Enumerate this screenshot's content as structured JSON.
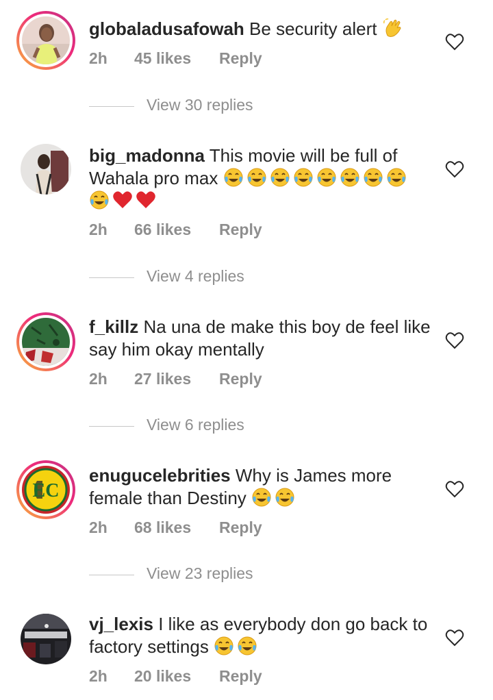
{
  "comments": [
    {
      "username": "globaladusafowah",
      "text": "Be security alert ",
      "emoji_trail": [
        "waving-hand"
      ],
      "time": "2h",
      "likes": "45 likes",
      "reply": "Reply",
      "view_replies": "View 30 replies"
    },
    {
      "username": "big_madonna",
      "text": "This movie will be full of Wahala pro max ",
      "emoji_trail": [
        "tears-of-joy",
        "tears-of-joy",
        "tears-of-joy",
        "tears-of-joy",
        "tears-of-joy",
        "tears-of-joy",
        "tears-of-joy",
        "tears-of-joy",
        "tears-of-joy",
        "red-heart",
        "red-heart"
      ],
      "time": "2h",
      "likes": "66 likes",
      "reply": "Reply",
      "view_replies": "View 4 replies"
    },
    {
      "username": "f_killz",
      "text": "Na una de make this boy de feel like say him okay mentally",
      "emoji_trail": [],
      "time": "2h",
      "likes": "27 likes",
      "reply": "Reply",
      "view_replies": "View 6 replies"
    },
    {
      "username": "enugucelebrities",
      "text": "Why is James more female than Destiny ",
      "emoji_trail": [
        "tears-of-joy",
        "tears-of-joy"
      ],
      "time": "2h",
      "likes": "68 likes",
      "reply": "Reply",
      "view_replies": "View 23 replies"
    },
    {
      "username": "vj_lexis",
      "text": "I like as everybody don go back to factory settings ",
      "emoji_trail": [
        "tears-of-joy",
        "tears-of-joy"
      ],
      "time": "2h",
      "likes": "20 likes",
      "reply": "Reply"
    }
  ],
  "colors": {
    "text": "#262626",
    "muted": "#8e8e8e",
    "story_ring_start": "#f9b43a",
    "story_ring_end": "#c13584"
  }
}
